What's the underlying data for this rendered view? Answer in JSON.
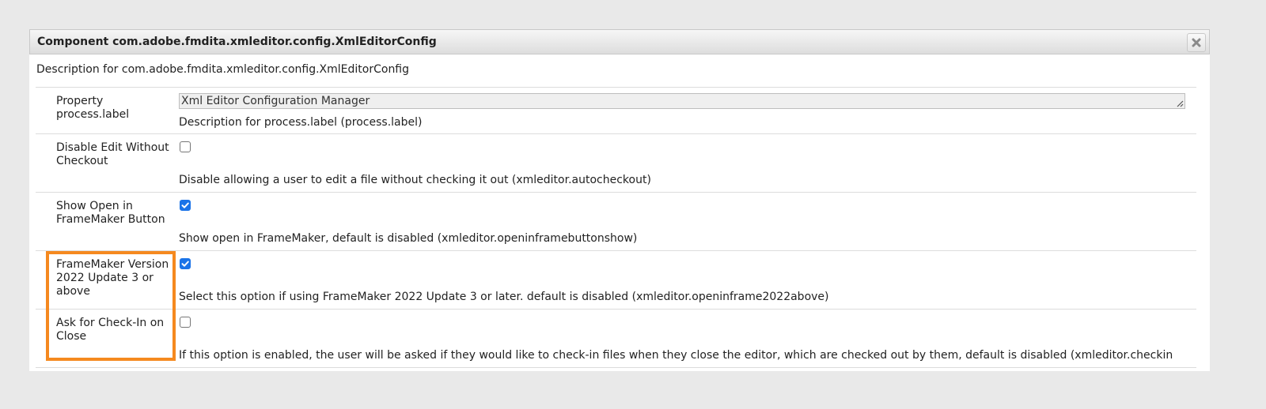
{
  "dialog": {
    "title": "Component com.adobe.fmdita.xmleditor.config.XmlEditorConfig",
    "close_icon": "close-icon",
    "description": "Description for com.adobe.fmdita.xmleditor.config.XmlEditorConfig"
  },
  "properties": [
    {
      "label": "Property process.label",
      "type": "text",
      "value": "Xml Editor Configuration Manager",
      "description": "Description for process.label (process.label)"
    },
    {
      "label": "Disable Edit Without Checkout",
      "type": "checkbox",
      "checked": false,
      "description": "Disable allowing a user to edit a file without checking it out (xmleditor.autocheckout)"
    },
    {
      "label": "Show Open in FrameMaker Button",
      "type": "checkbox",
      "checked": true,
      "description": "Show open in FrameMaker, default is disabled (xmleditor.openinframebuttonshow)"
    },
    {
      "label": "FrameMaker Version 2022 Update 3 or above",
      "type": "checkbox",
      "checked": true,
      "description": "Select this option if using FrameMaker 2022 Update 3 or later. default is disabled (xmleditor.openinframe2022above)"
    },
    {
      "label": "Ask for Check-In on Close",
      "type": "checkbox",
      "checked": false,
      "description": "If this option is enabled, the user will be asked if they would like to check-in files when they close the editor, which are checked out by them, default is disabled (xmleditor.checkin"
    }
  ],
  "colors": {
    "highlight": "#f5891f",
    "checkbox_checked": "#1a73e8",
    "page_background": "#e9e9e9"
  }
}
